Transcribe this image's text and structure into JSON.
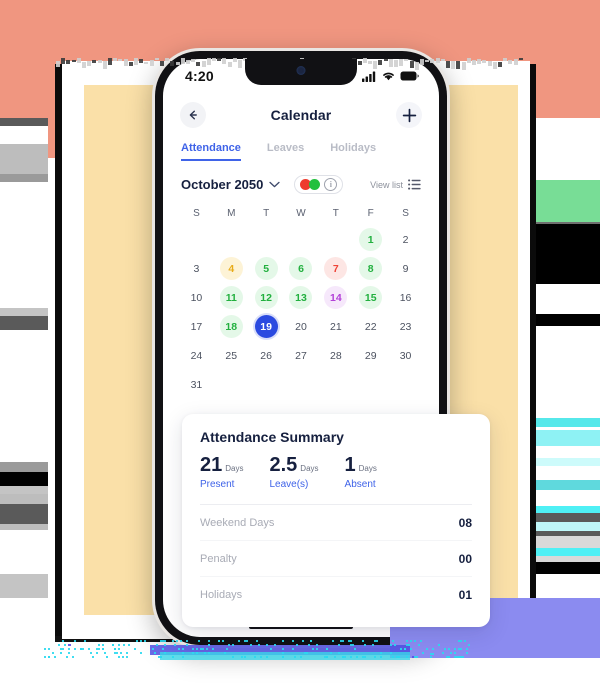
{
  "statusbar": {
    "time": "4:20",
    "icons": [
      "cellular-icon",
      "wifi-icon",
      "battery-icon"
    ]
  },
  "header": {
    "back_icon": "arrow-left-icon",
    "title": "Calendar",
    "add_label": "+"
  },
  "tabs": [
    {
      "label": "Attendance",
      "active": true
    },
    {
      "label": "Leaves",
      "active": false
    },
    {
      "label": "Holidays",
      "active": false
    }
  ],
  "month_bar": {
    "month_label": "October 2050",
    "chevron_icon": "chevron-down-icon",
    "legend": {
      "absent_color": "#ee3b2e",
      "present_color": "#22c03e",
      "info_icon": "info-icon",
      "info_label": "i"
    },
    "view_list_label": "View list",
    "view_list_icon": "list-icon"
  },
  "calendar": {
    "weekday_headers": [
      "S",
      "M",
      "T",
      "W",
      "T",
      "F",
      "S"
    ],
    "weeks": [
      [
        {
          "day": "",
          "state": "empty"
        },
        {
          "day": "",
          "state": "empty"
        },
        {
          "day": "",
          "state": "empty"
        },
        {
          "day": "",
          "state": "empty"
        },
        {
          "day": "",
          "state": "empty"
        },
        {
          "day": "1",
          "state": "present"
        },
        {
          "day": "2",
          "state": "none"
        }
      ],
      [
        {
          "day": "3",
          "state": "none"
        },
        {
          "day": "4",
          "state": "leave"
        },
        {
          "day": "5",
          "state": "present"
        },
        {
          "day": "6",
          "state": "present"
        },
        {
          "day": "7",
          "state": "absent"
        },
        {
          "day": "8",
          "state": "present"
        },
        {
          "day": "9",
          "state": "none"
        }
      ],
      [
        {
          "day": "10",
          "state": "none"
        },
        {
          "day": "11",
          "state": "present"
        },
        {
          "day": "12",
          "state": "present"
        },
        {
          "day": "13",
          "state": "present"
        },
        {
          "day": "14",
          "state": "holiday"
        },
        {
          "day": "15",
          "state": "present"
        },
        {
          "day": "16",
          "state": "none"
        }
      ],
      [
        {
          "day": "17",
          "state": "none"
        },
        {
          "day": "18",
          "state": "present"
        },
        {
          "day": "19",
          "state": "selected"
        },
        {
          "day": "20",
          "state": "none"
        },
        {
          "day": "21",
          "state": "none"
        },
        {
          "day": "22",
          "state": "none"
        },
        {
          "day": "23",
          "state": "none"
        }
      ],
      [
        {
          "day": "24",
          "state": "none"
        },
        {
          "day": "25",
          "state": "none"
        },
        {
          "day": "26",
          "state": "none"
        },
        {
          "day": "27",
          "state": "none"
        },
        {
          "day": "28",
          "state": "none"
        },
        {
          "day": "29",
          "state": "none"
        },
        {
          "day": "30",
          "state": "none"
        }
      ],
      [
        {
          "day": "31",
          "state": "none"
        },
        {
          "day": "",
          "state": "empty"
        },
        {
          "day": "",
          "state": "empty"
        },
        {
          "day": "",
          "state": "empty"
        },
        {
          "day": "",
          "state": "empty"
        },
        {
          "day": "",
          "state": "empty"
        },
        {
          "day": "",
          "state": "empty"
        }
      ]
    ]
  },
  "summary": {
    "title": "Attendance Summary",
    "stats": [
      {
        "value": "21",
        "unit": "Days",
        "label": "Present"
      },
      {
        "value": "2.5",
        "unit": "Days",
        "label": "Leave(s)"
      },
      {
        "value": "1",
        "unit": "Days",
        "label": "Absent"
      }
    ],
    "rows": [
      {
        "key": "Weekend Days",
        "value": "08"
      },
      {
        "key": "Penalty",
        "value": "00"
      },
      {
        "key": "Holidays",
        "value": "01"
      }
    ]
  },
  "theme": {
    "accent_blue": "#3f63e8",
    "selected_blue": "#2b4ae0",
    "present_green": "#22b03f",
    "leave_amber": "#e8ab18",
    "absent_red": "#ef4337",
    "holiday_purple": "#b341d8",
    "backdrop_coral": "#f09680",
    "panel_yellow": "#fae0a8",
    "title_navy": "#16203f"
  }
}
